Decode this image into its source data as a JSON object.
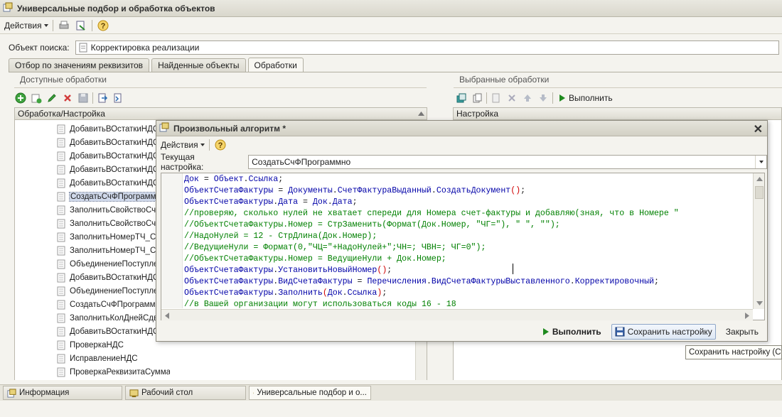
{
  "window": {
    "title": "Универсальные подбор и обработка объектов"
  },
  "toolbar": {
    "actions_label": "Действия"
  },
  "search": {
    "label": "Объект поиска:",
    "value": "Корректировка реализации"
  },
  "tabs": [
    {
      "label": "Отбор по значениям реквизитов"
    },
    {
      "label": "Найденные объекты"
    },
    {
      "label": "Обработки"
    }
  ],
  "left_panel": {
    "group_title": "Доступные обработки",
    "column_header": "Обработка/Настройка",
    "items": [
      "ДобавитьВОстаткиНДС",
      "ДобавитьВОстаткиНДС_Р",
      "ДобавитьВОстаткиНДС_К",
      "ДобавитьВОстаткиНДС_К",
      "ДобавитьВОстаткиНДС_Р",
      "СоздатьСчФПрограммно",
      "ЗаполнитьСвойствоСчФПр",
      "ЗаполнитьСвойствоСчФВы",
      "ЗаполнитьНомерТЧ_СЧФ",
      "ЗаполнитьНомерТЧ_СЧФ",
      "ОбъединениеПоступлений",
      "ДобавитьВОстаткиНДС_К",
      "ОбъединениеПоступлений",
      "СоздатьСчФПрограммно_",
      "ЗаполнитьКолДнейСдвига",
      "ДобавитьВОстаткиНДС_К",
      "ПроверкаНДС",
      "ИсправлениеНДС",
      "ПроверкаРеквизитаСуммаВключаетНДС"
    ],
    "selected_index": 5
  },
  "right_panel": {
    "group_title": "Выбранные обработки",
    "run_label": "Выполнить",
    "column_header": "Настройка"
  },
  "dialog": {
    "title": "Произвольный алгоритм *",
    "actions_label": "Действия",
    "setting_label": "Текущая настройка:",
    "setting_value": "СоздатьСчФПрограммно",
    "code_lines": [
      [
        [
          "id",
          "Док"
        ],
        [
          "st",
          " = "
        ],
        [
          "id",
          "Объект"
        ],
        [
          "st",
          "."
        ],
        [
          "id",
          "Ссылка"
        ],
        [
          "st",
          ";"
        ]
      ],
      [
        [
          "id",
          "ОбъектСчетаФактуры"
        ],
        [
          "st",
          " = "
        ],
        [
          "id",
          "Документы"
        ],
        [
          "st",
          "."
        ],
        [
          "id",
          "СчетФактураВыданный"
        ],
        [
          "st",
          "."
        ],
        [
          "id",
          "СоздатьДокумент"
        ],
        [
          "kw",
          "()"
        ],
        [
          "st",
          ";"
        ]
      ],
      [
        [
          "id",
          "ОбъектСчетаФактуры"
        ],
        [
          "st",
          "."
        ],
        [
          "id",
          "Дата"
        ],
        [
          "st",
          " = "
        ],
        [
          "id",
          "Док"
        ],
        [
          "st",
          "."
        ],
        [
          "id",
          "Дата"
        ],
        [
          "st",
          ";"
        ]
      ],
      [
        [
          "cm",
          "//проверяю, сколько нулей не хватает спереди для Номера счет-фактуры и добавляю(зная, что в Номере \""
        ]
      ],
      [
        [
          "cm",
          "//ОбъектСчетаФактуры.Номер = СтрЗаменить(Формат(Док.Номер, \"ЧГ=\"), \" \", \"\");"
        ]
      ],
      [
        [
          "cm",
          "//НадоНулей = 12 - СтрДлина(Док.Номер);"
        ]
      ],
      [
        [
          "cm",
          "//ВедущиеНули = Формат(0,\"ЧЦ=\"+НадоНулей+\";ЧН=; ЧВН=; ЧГ=0\");"
        ]
      ],
      [
        [
          "cm",
          "//ОбъектСчетаФактуры.Номер = ВедущиеНули + Док.Номер;"
        ]
      ],
      [
        [
          "id",
          "ОбъектСчетаФактуры"
        ],
        [
          "st",
          "."
        ],
        [
          "id",
          "УстановитьНовыйНомер"
        ],
        [
          "kw",
          "()"
        ],
        [
          "st",
          ";"
        ]
      ],
      [
        [
          "id",
          "ОбъектСчетаФактуры"
        ],
        [
          "st",
          "."
        ],
        [
          "id",
          "ВидСчетаФактуры"
        ],
        [
          "st",
          " = "
        ],
        [
          "id",
          "Перечисления"
        ],
        [
          "st",
          "."
        ],
        [
          "id",
          "ВидСчетаФактурыВыставленного"
        ],
        [
          "st",
          "."
        ],
        [
          "id",
          "Корректировочный"
        ],
        [
          "st",
          ";"
        ]
      ],
      [
        [
          "id",
          "ОбъектСчетаФактуры"
        ],
        [
          "st",
          "."
        ],
        [
          "id",
          "Заполнить"
        ],
        [
          "kw",
          "("
        ],
        [
          "id",
          "Док"
        ],
        [
          "st",
          "."
        ],
        [
          "id",
          "Ссылка"
        ],
        [
          "kw",
          ")"
        ],
        [
          "st",
          ";"
        ]
      ],
      [
        [
          "cm",
          "//в Вашей организации могут использоваться коды 16 - 18"
        ]
      ]
    ],
    "run_label": "Выполнить",
    "save_label": "Сохранить настройку",
    "close_label": "Закрыть"
  },
  "tooltip": {
    "text": "Сохранить настройку (Ctrl+"
  },
  "taskbar": [
    {
      "label": "Информация"
    },
    {
      "label": "Рабочий стол"
    },
    {
      "label": "Универсальные подбор и о..."
    }
  ]
}
